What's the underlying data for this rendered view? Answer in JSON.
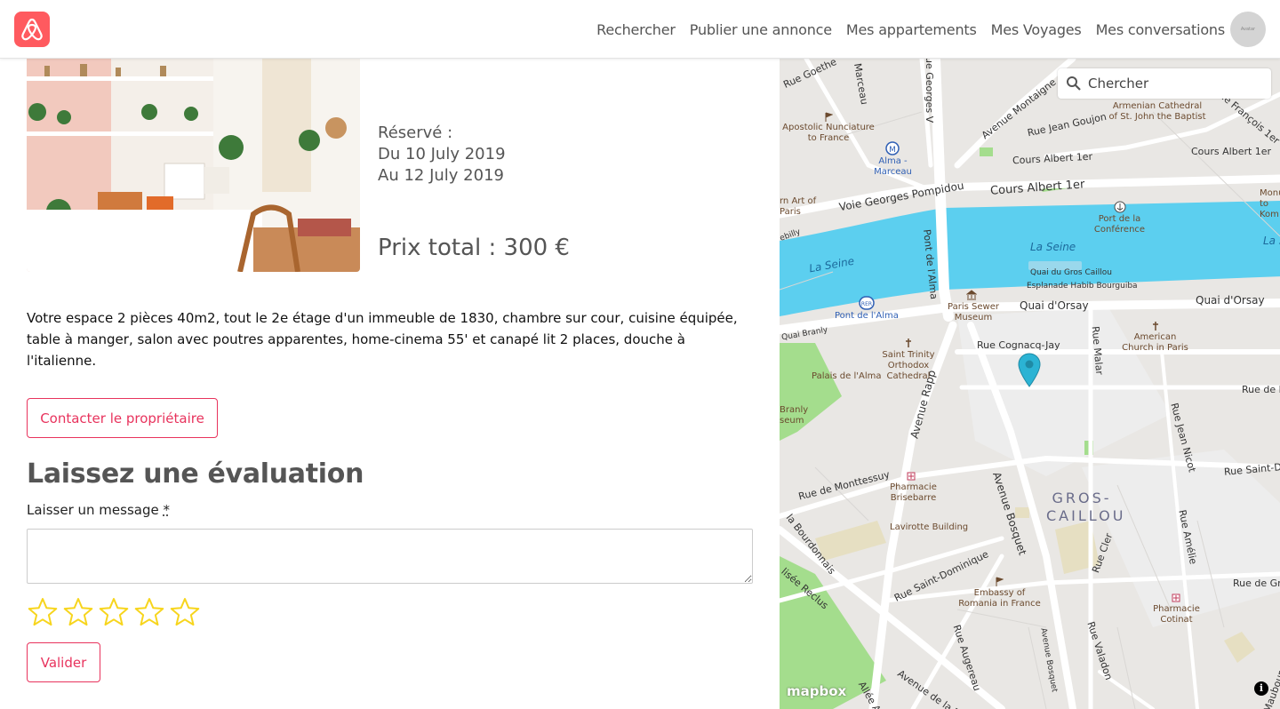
{
  "header": {
    "nav": [
      "Rechercher",
      "Publier une annonce",
      "Mes appartements",
      "Mes Voyages",
      "Mes conversations"
    ],
    "avatar_alt": "Avatar",
    "brand_color": "#ff5a5f"
  },
  "booking": {
    "reserved_label": "Réservé :",
    "from": "Du 10 July 2019",
    "to": "Au 12 July 2019",
    "total_price": "Prix total : 300 €"
  },
  "description": "Votre espace 2 pièces 40m2, tout le 2e étage d'un immeuble de 1830, chambre sur cour, cuisine équipée, table à manger, salon avec poutres apparentes, home-cinema 55' et canapé lit 2 places, douche à l'italienne.",
  "contact_button": "Contacter le propriétaire",
  "review": {
    "title": "Laissez une évaluation",
    "message_label": "Laisser un message",
    "required_mark": "*",
    "rating": 0,
    "max_rating": 5,
    "submit_label": "Valider"
  },
  "map": {
    "search_placeholder": "Chercher",
    "streets": [
      "Rue Goethe",
      "Marceau",
      "Rue Georges V",
      "Avenue Montaigne",
      "Rue Jean Goujon",
      "Rue François 1er",
      "Cours Albert 1er",
      "Cours Albert 1er",
      "Cours Albert 1er",
      "Voie Georges Pompidou",
      "Pont de l'Alma",
      "Quai du Gros Caillou",
      "Esplanade Habib Bourguiba",
      "Quai d'Orsay",
      "Quai d'Orsay",
      "Quai Branly",
      "Rue Cognacq-Jay",
      "Rue Malar",
      "Rue de l",
      "Avenue Rapp",
      "Rue Jean Nicot",
      "Rue Saint-D",
      "Rue de Monttessuy",
      "Avenue Bosquet",
      "Rue Amélie",
      "Rue Cler",
      "Rue de Gre",
      "Rue Saint-Dominique",
      "Rue Augereau",
      "Avenue Bosquet",
      "Rue Valadon",
      "Avenue de la Bo",
      "la Bourdonnais",
      "lisée Reclus",
      "Allée A",
      "ur Maubourg",
      "ebilly"
    ],
    "pois": [
      "Apostolic Nunciature to France",
      "Armenian Cathedral of St. John the Baptist",
      "Alma - Marceau",
      "rn Art of Paris",
      "Port de la Conférence",
      "Monu to Kom",
      "Pont de l'Alma",
      "Paris Sewer Museum",
      "American Church in Paris",
      "Saint Trinity Orthodox Cathedral",
      "Palais de l'Alma",
      "Branly seum",
      "Pharmacie Brisebarre",
      "Lavirotte Building",
      "Embassy of Romania in France",
      "Pharmacie Cotinat"
    ],
    "river_labels": [
      "La Seine",
      "La Seine",
      "La S"
    ],
    "district": "GROS-CAILLOU",
    "attribution": "mapbox",
    "info_label": "i",
    "water_color": "#5ccfef",
    "park_color": "#9fe08c",
    "marker_color": "#2bb3d4"
  },
  "accent_color": "#e8335d",
  "star_color": "#f7d51d"
}
